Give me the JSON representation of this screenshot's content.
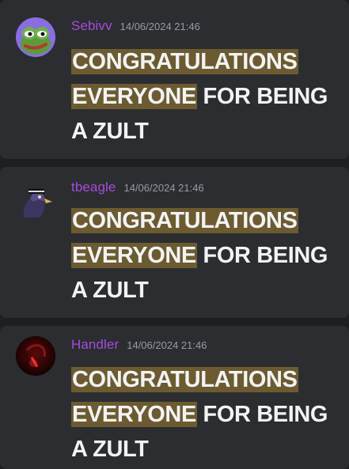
{
  "messages": [
    {
      "username": "Sebivv",
      "timestamp": "14/06/2024 21:46",
      "highlight_1": "CONGRATULATIONS",
      "highlight_2": "EVERYONE",
      "text_rest": " FOR BEING A ZULT",
      "avatar_icon": "pepe-frog-avatar"
    },
    {
      "username": "tbeagle",
      "timestamp": "14/06/2024 21:46",
      "highlight_1": "CONGRATULATIONS",
      "highlight_2": "EVERYONE",
      "text_rest": " FOR BEING A ZULT",
      "avatar_icon": "eagle-avatar"
    },
    {
      "username": "Handler",
      "timestamp": "14/06/2024 21:46",
      "highlight_1": "CONGRATULATIONS",
      "highlight_2": "EVERYONE",
      "text_rest": " FOR BEING A ZULT",
      "avatar_icon": "dark-red-avatar"
    }
  ],
  "colors": {
    "background": "#1e1f22",
    "message_bg": "#2b2d31",
    "username": "#a64bdb",
    "timestamp": "#949ba4",
    "text": "#f2f3f5",
    "highlight": "#6c5b30"
  }
}
